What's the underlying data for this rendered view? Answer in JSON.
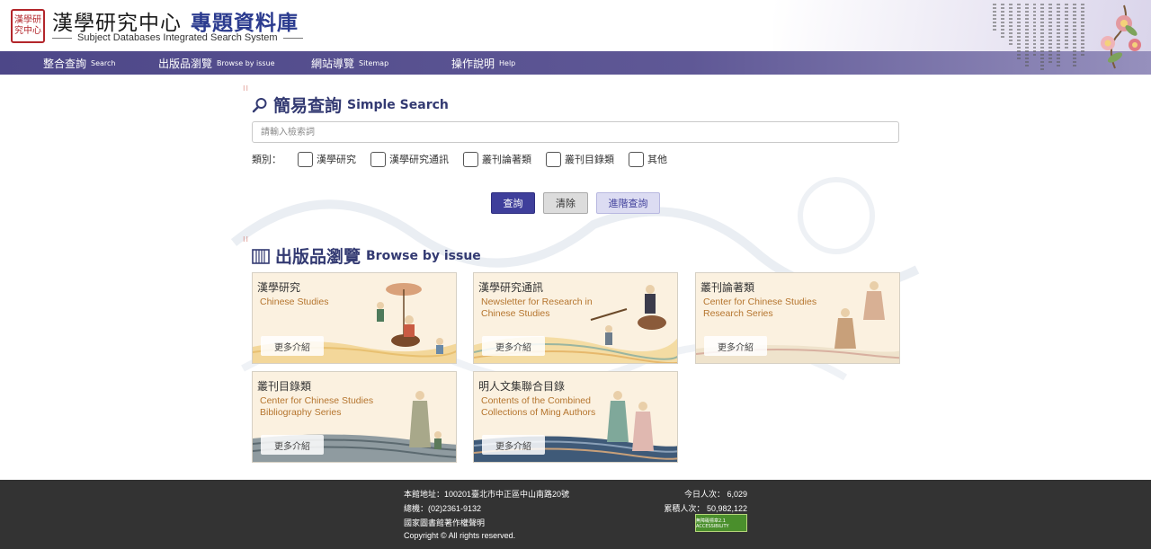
{
  "header": {
    "seal_text": "漢學研究中心",
    "org_name": "漢學研究中心",
    "db_name": "專題資料庫",
    "subtitle": "Subject Databases Integrated Search System"
  },
  "nav": [
    {
      "zh": "整合查詢",
      "en": "Search"
    },
    {
      "zh": "出版品瀏覽",
      "en": "Browse by issue"
    },
    {
      "zh": "網站導覽",
      "en": "Sitemap"
    },
    {
      "zh": "操作說明",
      "en": "Help"
    }
  ],
  "simple_search": {
    "title_zh": "簡易查詢",
    "title_en": "Simple Search",
    "placeholder": "請輸入檢索詞",
    "category_label": "類別：",
    "categories": [
      "漢學研究",
      "漢學研究通訊",
      "叢刊論著類",
      "叢刊目錄類",
      "其他"
    ],
    "buttons": {
      "search": "查詢",
      "clear": "清除",
      "advanced": "進階查詢"
    }
  },
  "browse": {
    "title_zh": "出版品瀏覽",
    "title_en": "Browse by issue",
    "more_label": "更多介紹",
    "cards": [
      {
        "title": "漢學研究",
        "subtitle_lines": [
          "Chinese Studies"
        ]
      },
      {
        "title": "漢學研究通訊",
        "subtitle_lines": [
          "Newsletter for Research in",
          "Chinese Studies"
        ]
      },
      {
        "title": "叢刊論著類",
        "subtitle_lines": [
          "Center for Chinese Studies",
          "Research Series"
        ]
      },
      {
        "title": "叢刊目錄類",
        "subtitle_lines": [
          "Center for Chinese Studies",
          "Bibliography Series"
        ]
      },
      {
        "title": "明人文集聯合目錄",
        "subtitle_lines": [
          "Contents of the Combined",
          "Collections of Ming Authors"
        ]
      }
    ]
  },
  "footer": {
    "address": "本館地址：100201臺北市中正區中山南路20號",
    "phone": "總機：(02)2361-9132",
    "copyright_notice": "國家圖書館著作權聲明",
    "copyright": "Copyright © All rights reserved.",
    "today_label": "今日人次：",
    "today_value": "6,029",
    "total_label": "累積人次：",
    "total_value": "50,982,122",
    "badge_text": "無障礙標章2.1 ACCESSIBILITY"
  },
  "colors": {
    "nav": "#5b5391",
    "accent": "#333a72",
    "search_button": "#3f3f9b",
    "footer": "#333333",
    "card_subtitle": "#b5752e"
  }
}
